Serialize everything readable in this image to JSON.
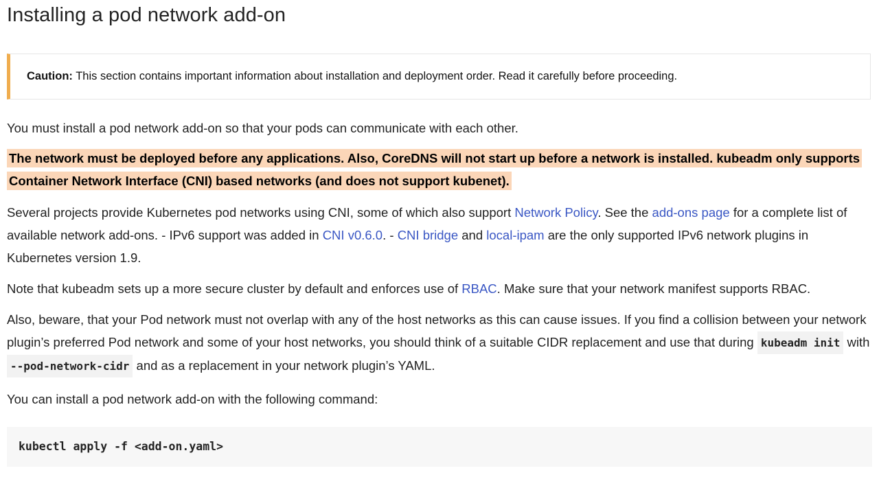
{
  "title": "Installing a pod network add-on",
  "caution": {
    "label": "Caution:",
    "text": " This section contains important information about installation and deployment order. Read it carefully before proceeding."
  },
  "p1": "You must install a pod network add-on so that your pods can communicate with each other.",
  "p2": "The network must be deployed before any applications. Also, CoreDNS will not start up before a network is installed. kubeadm only supports Container Network Interface (CNI) based networks (and does not support kubenet).",
  "p3": {
    "t1": "Several projects provide Kubernetes pod networks using CNI, some of which also support ",
    "link_network_policy": "Network Policy",
    "t2": ". See the ",
    "link_addons_page": "add-ons page",
    "t3": " for a complete list of available network add-ons. - IPv6 support was added in ",
    "link_cni_version": "CNI v0.6.0",
    "t4": ". - ",
    "link_cni_bridge": "CNI bridge",
    "t5": " and ",
    "link_local_ipam": "local-ipam",
    "t6": " are the only supported IPv6 network plugins in Kubernetes version 1.9."
  },
  "p4": {
    "t1": "Note that kubeadm sets up a more secure cluster by default and enforces use of ",
    "link_rbac": "RBAC",
    "t2": ". Make sure that your network manifest supports RBAC."
  },
  "p5": {
    "t1": "Also, beware, that your Pod network must not overlap with any of the host networks as this can cause issues. If you find a collision between your network plugin’s preferred Pod network and some of your host networks, you should think of a suitable CIDR replacement and use that during ",
    "code1": "kubeadm init",
    "t2": " with ",
    "code2": "--pod-network-cidr",
    "t3": " and as a replacement in your network plugin’s YAML."
  },
  "p6": "You can install a pod network add-on with the following command:",
  "command": "kubectl apply -f <add-on.yaml>",
  "colors": {
    "caution_border": "#f0ad4e",
    "highlight": "#fbd6b8",
    "link": "#3a57c4",
    "code_bg": "#f7f7f7"
  }
}
